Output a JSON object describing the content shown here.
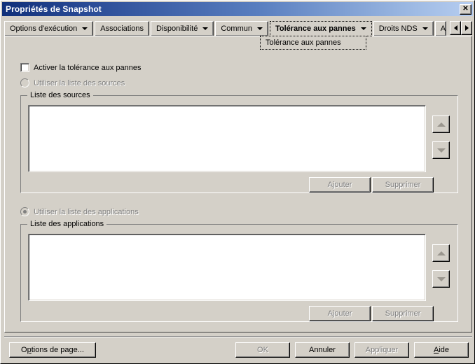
{
  "window": {
    "title": "Propriétés de Snapshot",
    "close_label": "✕",
    "close_icon": "close-icon"
  },
  "tabs": [
    {
      "label": "Options d'exécution",
      "has_arrow": true,
      "active": false
    },
    {
      "label": "Associations",
      "has_arrow": false,
      "active": false
    },
    {
      "label": "Disponibilité",
      "has_arrow": true,
      "active": false
    },
    {
      "label": "Commun",
      "has_arrow": true,
      "active": false
    },
    {
      "label": "Tolérance aux pannes",
      "has_arrow": true,
      "active": true
    },
    {
      "label": "Droits NDS",
      "has_arrow": true,
      "active": false
    },
    {
      "label": "Aut",
      "has_arrow": false,
      "active": false
    }
  ],
  "tab_scroll": {
    "left_icon": "triangle-left-icon",
    "right_icon": "triangle-right-icon"
  },
  "tab_dropdown": {
    "item_label": "Tolérance aux pannes"
  },
  "page": {
    "enable_checkbox": {
      "label": "Activer la tolérance aux pannes",
      "checked": false,
      "enabled": true
    },
    "radio_sources": {
      "label": "Utiliser la liste des sources",
      "selected": false,
      "enabled": false
    },
    "sources_group": {
      "title": "Liste des sources",
      "items": [],
      "add_button": "Ajouter",
      "remove_button": "Supprimer",
      "move_up_icon": "triangle-up-icon",
      "move_down_icon": "triangle-down-icon"
    },
    "radio_applications": {
      "label": "Utiliser la liste des applications",
      "selected": true,
      "enabled": false
    },
    "applications_group": {
      "title": "Liste des applications",
      "items": [],
      "add_button": "Ajouter",
      "remove_button": "Supprimer",
      "move_up_icon": "triangle-up-icon",
      "move_down_icon": "triangle-down-icon"
    }
  },
  "footer": {
    "page_options": "Options de page...",
    "page_options_accel": "p",
    "ok": "OK",
    "cancel": "Annuler",
    "apply": "Appliquer",
    "help": "Aide",
    "help_accel": "A"
  },
  "colors": {
    "dialog_face": "#d4d0c8",
    "title_start": "#10307a",
    "title_end": "#b6cdf0",
    "disabled_text": "#808080",
    "listbox_bg": "#ffffff"
  }
}
